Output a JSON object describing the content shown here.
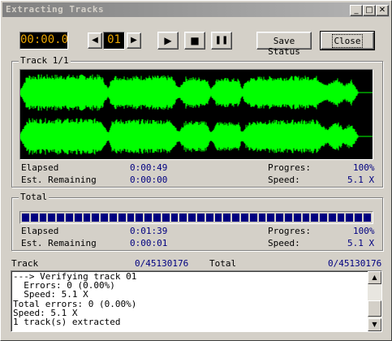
{
  "window": {
    "title": "Extracting Tracks",
    "controls": {
      "minimize": "_",
      "maximize": "□",
      "close": "✕"
    }
  },
  "toolbar": {
    "time": "00:00.0",
    "track_number": "01",
    "prev_icon": "◀",
    "next_icon": "▶",
    "play_icon": "▶",
    "stop_icon": "■",
    "pause_icon": "❚❚",
    "save_status_label": "Save Status",
    "close_label": "Close"
  },
  "track_group": {
    "label": "Track 1/1",
    "elapsed_label": "Elapsed",
    "elapsed_value": "0:00:49",
    "remaining_label": "Est. Remaining",
    "remaining_value": "0:00:00",
    "progress_label": "Progres:",
    "progress_value": "100%",
    "speed_label": "Speed:",
    "speed_value": "5.1 X",
    "waveform_color": "#00ff00"
  },
  "total_group": {
    "label": "Total",
    "progress_fraction": 1.0,
    "elapsed_label": "Elapsed",
    "elapsed_value": "0:01:39",
    "remaining_label": "Est. Remaining",
    "remaining_value": "0:00:01",
    "progress_label": "Progres:",
    "progress_value": "100%",
    "speed_label": "Speed:",
    "speed_value": "5.1 X"
  },
  "summary": {
    "track_label": "Track",
    "track_value": "0/45130176",
    "total_label": "Total",
    "total_value": "0/45130176"
  },
  "log": {
    "lines": [
      "---> Verifying track 01",
      "  Errors: 0 (0.00%)",
      "  Speed: 5.1 X",
      "Total errors: 0 (0.00%)",
      "Speed: 5.1 X",
      "1 track(s) extracted"
    ]
  },
  "colors": {
    "face": "#d4d0c8",
    "accent_blue": "#000080",
    "lcd_text": "#e8a400"
  }
}
